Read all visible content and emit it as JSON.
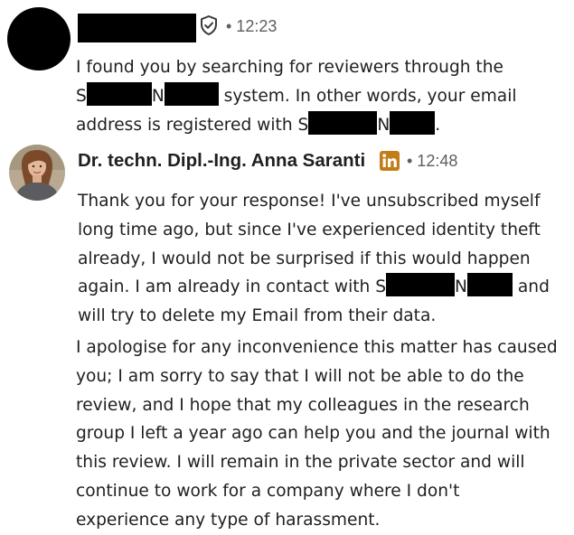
{
  "message1": {
    "time": "• 12:23",
    "lines": {
      "l1": "I found you by searching for reviewers through the",
      "l2_a": "S",
      "l2_b": "N",
      "l2_c": "system. In other words, your email",
      "l3_a": "address is registered with S",
      "l3_b": "N",
      "l3_c": "."
    }
  },
  "message2": {
    "sender": "Dr. techn. Dipl.-Ing. Anna Saranti",
    "time": "• 12:48",
    "lines": {
      "l1": "Thank you for your response! I've unsubscribed myself",
      "l2": "long time ago, but since I've experienced identity theft",
      "l3": "already, I would not be surprised if this would happen",
      "l4_a": "again. I am already in contact with S",
      "l4_b": "N",
      "l4_c": "and",
      "l5": "will try to delete my Email from their data."
    }
  },
  "message3": {
    "lines": {
      "l1": "I apologise for any inconvenience this matter has caused",
      "l2": "you; I am sorry to say that I will not be able to do the",
      "l3": "review, and I hope that my colleagues in the research",
      "l4": "group I left a year ago can help you and the journal with",
      "l5": "this review. I will remain in the private sector and will",
      "l6": "continue to work for a company where I don't",
      "l7": "experience any type of harassment."
    }
  },
  "colors": {
    "text": "#1f1f1f",
    "meta": "#5e5e5e",
    "linkedin": "#c37d16",
    "redaction": "#000000"
  },
  "icons": {
    "verified": "shield-check-icon",
    "badge": "linkedin-premium-icon"
  }
}
